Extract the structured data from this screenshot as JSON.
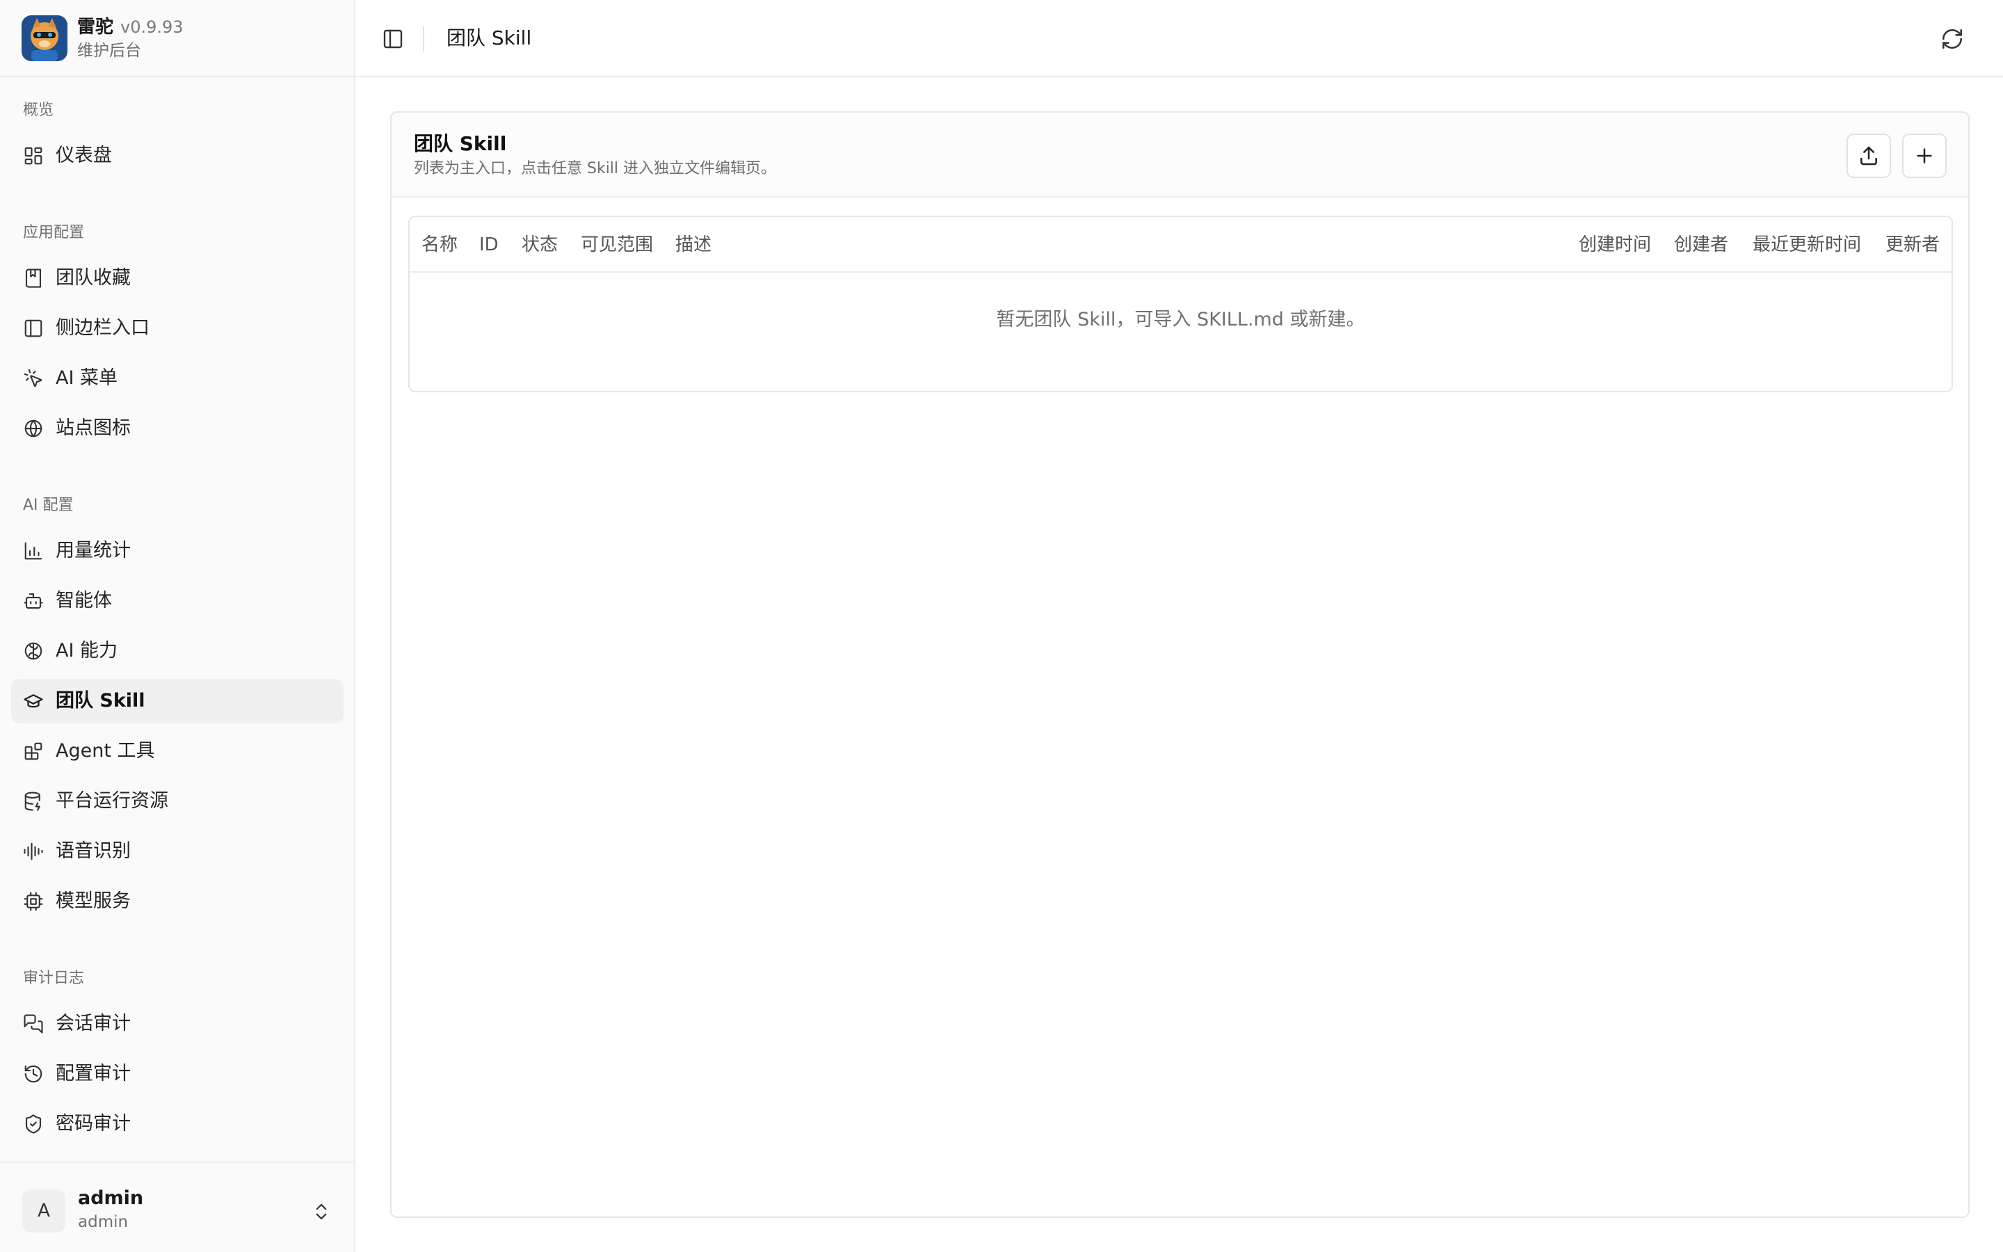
{
  "brand": {
    "name": "雷驼",
    "version": "v0.9.93",
    "subtitle": "维护后台"
  },
  "nav": {
    "groups": [
      {
        "label": "概览",
        "items": [
          {
            "label": "仪表盘",
            "icon": "dashboard-icon"
          }
        ]
      },
      {
        "label": "应用配置",
        "items": [
          {
            "label": "团队收藏",
            "icon": "bookmark-icon"
          },
          {
            "label": "侧边栏入口",
            "icon": "sidebar-icon"
          },
          {
            "label": "AI 菜单",
            "icon": "pointer-click-icon"
          },
          {
            "label": "站点图标",
            "icon": "globe-icon"
          }
        ]
      },
      {
        "label": "AI 配置",
        "items": [
          {
            "label": "用量统计",
            "icon": "bar-chart-icon"
          },
          {
            "label": "智能体",
            "icon": "bot-icon"
          },
          {
            "label": "AI 能力",
            "icon": "brain-icon"
          },
          {
            "label": "团队 Skill",
            "icon": "graduation-cap-icon",
            "active": true
          },
          {
            "label": "Agent 工具",
            "icon": "blocks-icon"
          },
          {
            "label": "平台运行资源",
            "icon": "database-icon"
          },
          {
            "label": "语音识别",
            "icon": "audio-waveform-icon"
          },
          {
            "label": "模型服务",
            "icon": "cpu-icon"
          }
        ]
      },
      {
        "label": "审计日志",
        "items": [
          {
            "label": "会话审计",
            "icon": "messages-icon"
          },
          {
            "label": "配置审计",
            "icon": "history-icon"
          },
          {
            "label": "密码审计",
            "icon": "shield-check-icon"
          }
        ]
      }
    ]
  },
  "user": {
    "avatar_letter": "A",
    "name": "admin",
    "role": "admin"
  },
  "topbar": {
    "title": "团队 Skill"
  },
  "card": {
    "title": "团队 Skill",
    "description": "列表为主入口，点击任意 Skill 进入独立文件编辑页。",
    "columns": [
      "名称",
      "ID",
      "状态",
      "可见范围",
      "描述",
      "创建时间",
      "创建者",
      "最近更新时间",
      "更新者"
    ],
    "empty_message": "暂无团队 Skill，可导入 SKILL.md 或新建。"
  }
}
